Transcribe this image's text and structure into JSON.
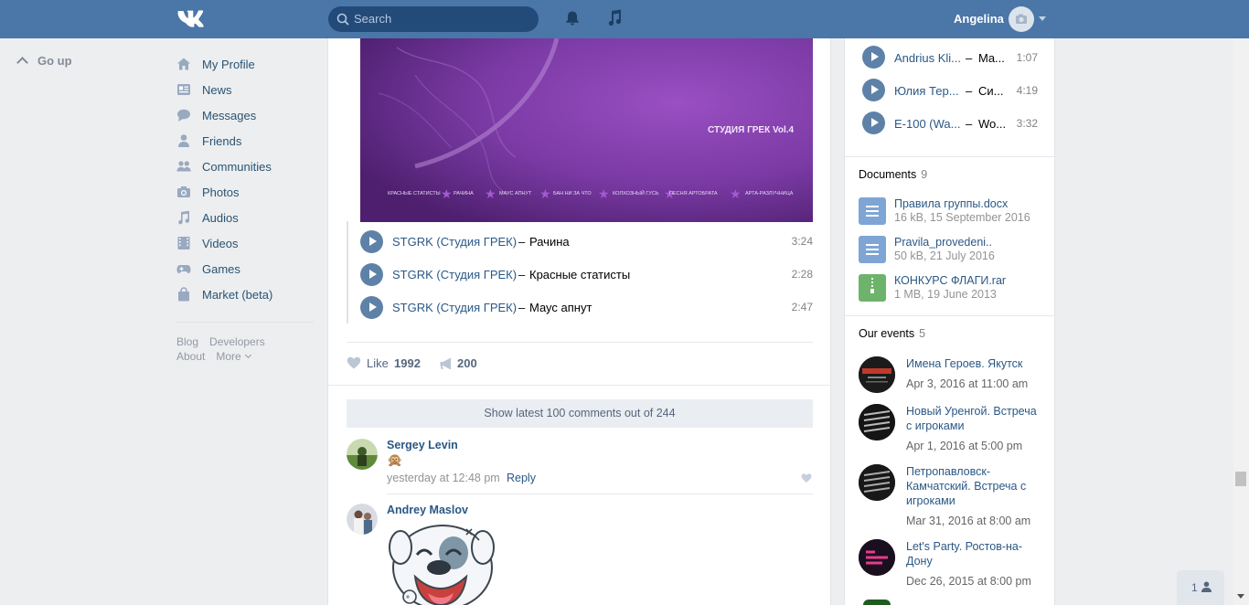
{
  "header": {
    "search_placeholder": "Search",
    "user_name": "Angelina"
  },
  "left": {
    "go_up": "Go up",
    "nav": [
      {
        "label": "My Profile"
      },
      {
        "label": "News"
      },
      {
        "label": "Messages"
      },
      {
        "label": "Friends"
      },
      {
        "label": "Communities"
      },
      {
        "label": "Photos"
      },
      {
        "label": "Audios"
      },
      {
        "label": "Videos"
      },
      {
        "label": "Games"
      },
      {
        "label": "Market (beta)"
      }
    ],
    "footer": {
      "blog": "Blog",
      "developers": "Developers",
      "about": "About",
      "more": "More"
    }
  },
  "post": {
    "cover_title": "СТУДИЯ ГРЕК Vol.4",
    "cover_tracks": [
      "КРАСНЫЕ СТАТИСТЫ",
      "РАЧИНА",
      "МАУС АПНУТ",
      "БАН НИ ЗА ЧТО",
      "КОЛХОЗНЫЙ ГУСЬ",
      "ПЕСНЯ АРТОБРАТА",
      "АРТА-РАЗЛУЧНИЦА"
    ],
    "tracks": [
      {
        "artist": "STGRK (Студия ГРЕК)",
        "title": "Рачина",
        "duration": "3:24"
      },
      {
        "artist": "STGRK (Студия ГРЕК)",
        "title": "Красные статисты",
        "duration": "2:28"
      },
      {
        "artist": "STGRK (Студия ГРЕК)",
        "title": "Маус апнут",
        "duration": "2:47"
      }
    ],
    "like_label": "Like",
    "like_count": "1992",
    "share_count": "200",
    "show_comments": "Show latest 100 comments out of 244"
  },
  "comments": [
    {
      "author": "Sergey Levin",
      "emoji": "🙊",
      "date": "yesterday at 12:48 pm",
      "reply": "Reply"
    },
    {
      "author": "Andrey Maslov"
    }
  ],
  "right": {
    "audios": [
      {
        "artist": "Andrius Kli...",
        "title": "Ma...",
        "duration": "1:07"
      },
      {
        "artist": "Юлия Тер...",
        "title": "Си...",
        "duration": "4:19"
      },
      {
        "artist": "E-100 (Wa...",
        "title": "Wo...",
        "duration": "3:32"
      }
    ],
    "documents_title": "Documents",
    "documents_count": "9",
    "documents": [
      {
        "name": "Правила группы.docx",
        "meta": "16 kB, 15 September 2016"
      },
      {
        "name": "Pravila_provedeni..",
        "meta": "50 kB, 21 July 2016"
      },
      {
        "name": "КОНКУРС ФЛАГИ.rar",
        "meta": "1 MB, 19 June 2013"
      }
    ],
    "events_title": "Our events",
    "events_count": "5",
    "events": [
      {
        "name": "Имена Героев. Якутск",
        "date": "Apr 3, 2016 at 11:00 am"
      },
      {
        "name": "Новый Уренгой. Встреча с игроками",
        "date": "Apr 1, 2016 at 5:00 pm"
      },
      {
        "name": "Петропавловск-Камчатский. Встреча с игроками",
        "date": "Mar 31, 2016 at 8:00 am"
      },
      {
        "name": "Let's Party. Ростов-на-Дону",
        "date": "Dec 26, 2015 at 8:00 pm"
      }
    ]
  },
  "chat": {
    "count": "1"
  },
  "colors": {
    "header": "#4a76a8",
    "link": "#2a5885",
    "background": "#edeef0"
  }
}
